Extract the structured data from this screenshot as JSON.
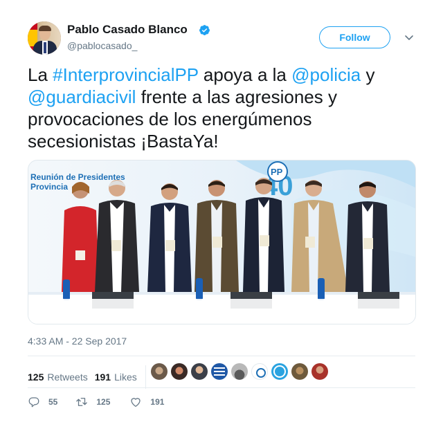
{
  "author": {
    "name": "Pablo Casado Blanco",
    "handle": "@pablocasado_",
    "verified": true
  },
  "header": {
    "follow_label": "Follow"
  },
  "tweet": {
    "t1": "La ",
    "hashtag": "#InterprovincialPP",
    "t2": " apoya a la ",
    "mention1": "@policia",
    "t3": " y ",
    "mention2": "@guardiacivil",
    "t4": " frente a las agresiones y provocaciones de los energúmenos secesionistas ¡BastaYa!"
  },
  "photo": {
    "banner_line1": "Reunión de Presidentes",
    "banner_line2": "Provincia"
  },
  "meta": {
    "timestamp": "4:33 AM - 22 Sep 2017"
  },
  "stats": {
    "retweets_count": "125",
    "retweets_label": "Retweets",
    "likes_count": "191",
    "likes_label": "Likes"
  },
  "actions": {
    "replies": "55",
    "retweets": "125",
    "likes": "191"
  },
  "colors": {
    "accent": "#1da1f2",
    "text": "#14171a",
    "muted": "#657786"
  }
}
